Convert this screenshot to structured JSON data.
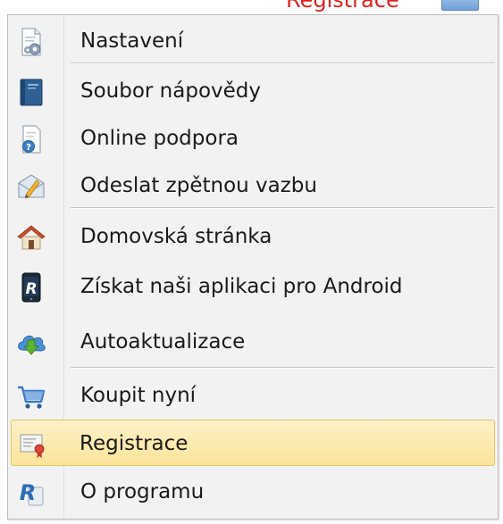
{
  "app": {
    "registration_link": "Registrace"
  },
  "menu": {
    "items": [
      {
        "label": "Nastavení",
        "icon": "settings-document-icon"
      },
      {
        "label": "Soubor nápovědy",
        "icon": "help-book-icon"
      },
      {
        "label": "Online podpora",
        "icon": "online-support-icon"
      },
      {
        "label": "Odeslat zpětnou vazbu",
        "icon": "feedback-envelope-icon"
      },
      {
        "label": "Domovská stránka",
        "icon": "home-icon"
      },
      {
        "label": "Získat naši aplikaci pro Android",
        "icon": "android-app-icon"
      },
      {
        "label": "Autoaktualizace",
        "icon": "cloud-download-icon"
      },
      {
        "label": "Koupit nyní",
        "icon": "shopping-cart-icon"
      },
      {
        "label": "Registrace",
        "icon": "certificate-icon",
        "selected": true
      },
      {
        "label": "O programu",
        "icon": "about-app-icon"
      }
    ]
  },
  "colors": {
    "highlight": "#fbe39a",
    "highlight_border": "#e8c465",
    "registration_link": "#e02020",
    "menu_background": "#f2f2f2"
  }
}
